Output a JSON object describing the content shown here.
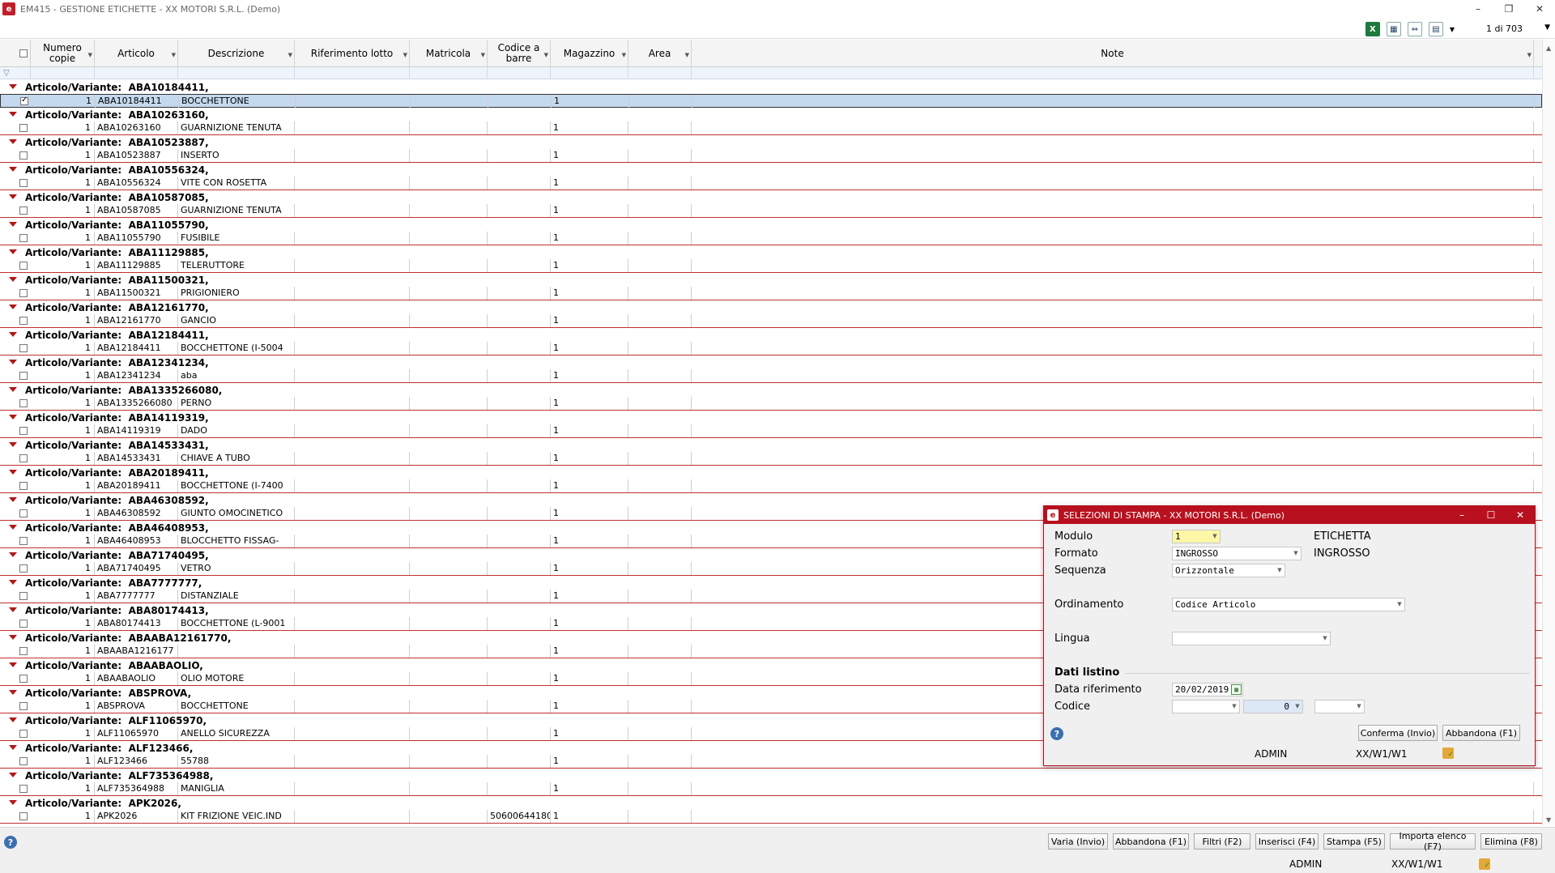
{
  "window": {
    "title": "EM415 - GESTIONE ETICHETTE - XX  MOTORI S.R.L.  (Demo)",
    "icon": "app-logo-icon"
  },
  "toolbar": {
    "pagecount": "1 di 703"
  },
  "columns": [
    {
      "key": "copie",
      "label": "Numero\ncopie"
    },
    {
      "key": "articolo",
      "label": "Articolo"
    },
    {
      "key": "descrizione",
      "label": "Descrizione"
    },
    {
      "key": "lotto",
      "label": "Riferimento lotto"
    },
    {
      "key": "matricola",
      "label": "Matricola"
    },
    {
      "key": "barre",
      "label": "Codice a\nbarre"
    },
    {
      "key": "magazzino",
      "label": "Magazzino"
    },
    {
      "key": "area",
      "label": "Area"
    },
    {
      "key": "note",
      "label": "Note"
    }
  ],
  "group_prefix": "Articolo/Variante:",
  "rows": [
    {
      "group": "ABA10184411,",
      "copie": "1",
      "articolo": "ABA10184411",
      "descrizione": "BOCCHETTONE",
      "barre": "",
      "magazzino": "1",
      "selected": true
    },
    {
      "group": "ABA10263160,",
      "copie": "1",
      "articolo": "ABA10263160",
      "descrizione": "GUARNIZIONE TENUTA",
      "barre": "",
      "magazzino": "1"
    },
    {
      "group": "ABA10523887,",
      "copie": "1",
      "articolo": "ABA10523887",
      "descrizione": "INSERTO",
      "barre": "",
      "magazzino": "1"
    },
    {
      "group": "ABA10556324,",
      "copie": "1",
      "articolo": "ABA10556324",
      "descrizione": "VITE CON ROSETTA",
      "barre": "",
      "magazzino": "1"
    },
    {
      "group": "ABA10587085,",
      "copie": "1",
      "articolo": "ABA10587085",
      "descrizione": "GUARNIZIONE TENUTA",
      "barre": "",
      "magazzino": "1"
    },
    {
      "group": "ABA11055790,",
      "copie": "1",
      "articolo": "ABA11055790",
      "descrizione": "FUSIBILE",
      "barre": "",
      "magazzino": "1"
    },
    {
      "group": "ABA11129885,",
      "copie": "1",
      "articolo": "ABA11129885",
      "descrizione": "TELERUTTORE",
      "barre": "",
      "magazzino": "1"
    },
    {
      "group": "ABA11500321,",
      "copie": "1",
      "articolo": "ABA11500321",
      "descrizione": "PRIGIONIERO",
      "barre": "",
      "magazzino": "1"
    },
    {
      "group": "ABA12161770,",
      "copie": "1",
      "articolo": "ABA12161770",
      "descrizione": "GANCIO",
      "barre": "",
      "magazzino": "1"
    },
    {
      "group": "ABA12184411,",
      "copie": "1",
      "articolo": "ABA12184411",
      "descrizione": "BOCCHETTONE (I-5004",
      "barre": "",
      "magazzino": "1"
    },
    {
      "group": "ABA12341234,",
      "copie": "1",
      "articolo": "ABA12341234",
      "descrizione": "aba",
      "barre": "",
      "magazzino": "1"
    },
    {
      "group": "ABA1335266080,",
      "copie": "1",
      "articolo": "ABA1335266080",
      "descrizione": "PERNO",
      "barre": "",
      "magazzino": "1"
    },
    {
      "group": "ABA14119319,",
      "copie": "1",
      "articolo": "ABA14119319",
      "descrizione": "DADO",
      "barre": "",
      "magazzino": "1"
    },
    {
      "group": "ABA14533431,",
      "copie": "1",
      "articolo": "ABA14533431",
      "descrizione": "CHIAVE A TUBO",
      "barre": "",
      "magazzino": "1"
    },
    {
      "group": "ABA20189411,",
      "copie": "1",
      "articolo": "ABA20189411",
      "descrizione": "BOCCHETTONE (I-7400",
      "barre": "",
      "magazzino": "1"
    },
    {
      "group": "ABA46308592,",
      "copie": "1",
      "articolo": "ABA46308592",
      "descrizione": "GIUNTO OMOCINETICO",
      "barre": "",
      "magazzino": "1"
    },
    {
      "group": "ABA46408953,",
      "copie": "1",
      "articolo": "ABA46408953",
      "descrizione": "BLOCCHETTO FISSAG-",
      "barre": "",
      "magazzino": "1"
    },
    {
      "group": "ABA71740495,",
      "copie": "1",
      "articolo": "ABA71740495",
      "descrizione": "VETRO",
      "barre": "",
      "magazzino": "1"
    },
    {
      "group": "ABA7777777,",
      "copie": "1",
      "articolo": "ABA7777777",
      "descrizione": "DISTANZIALE",
      "barre": "",
      "magazzino": "1"
    },
    {
      "group": "ABA80174413,",
      "copie": "1",
      "articolo": "ABA80174413",
      "descrizione": "BOCCHETTONE (L-9001",
      "barre": "",
      "magazzino": "1"
    },
    {
      "group": "ABAABA12161770,",
      "copie": "1",
      "articolo": "ABAABA1216177",
      "descrizione": "",
      "barre": "",
      "magazzino": "1"
    },
    {
      "group": "ABAABAOLIO,",
      "copie": "1",
      "articolo": "ABAABAOLIO",
      "descrizione": "OLIO MOTORE",
      "barre": "",
      "magazzino": "1"
    },
    {
      "group": "ABSPROVA,",
      "copie": "1",
      "articolo": "ABSPROVA",
      "descrizione": "BOCCHETTONE",
      "barre": "",
      "magazzino": "1"
    },
    {
      "group": "ALF11065970,",
      "copie": "1",
      "articolo": "ALF11065970",
      "descrizione": "ANELLO SICUREZZA",
      "barre": "",
      "magazzino": "1"
    },
    {
      "group": "ALF123466,",
      "copie": "1",
      "articolo": "ALF123466",
      "descrizione": "55788",
      "barre": "",
      "magazzino": "1"
    },
    {
      "group": "ALF735364988,",
      "copie": "1",
      "articolo": "ALF735364988",
      "descrizione": "MANIGLIA",
      "barre": "",
      "magazzino": "1"
    },
    {
      "group": "APK2026,",
      "copie": "1",
      "articolo": "APK2026",
      "descrizione": "KIT FRIZIONE VEIC.IND",
      "barre": "50600644180",
      "magazzino": "1"
    }
  ],
  "bottom_buttons": [
    "Varia (Invio)",
    "Abbandona (F1)",
    "Filtri (F2)",
    "Inserisci (F4)",
    "Stampa (F5)",
    "Importa elenco (F7)",
    "Elimina (F8)"
  ],
  "status": {
    "user": "ADMIN",
    "path": "XX/W1/W1"
  },
  "dialog": {
    "title": "SELEZIONI DI STAMPA - XX  MOTORI S.R.L.  (Demo)",
    "modulo_label": "Modulo",
    "modulo_value": "1",
    "modulo_desc": "ETICHETTA",
    "formato_label": "Formato",
    "formato_value": "INGROSSO",
    "formato_desc": "INGROSSO",
    "sequenza_label": "Sequenza",
    "sequenza_value": "Orizzontale",
    "ordinamento_label": "Ordinamento",
    "ordinamento_value": "Codice Articolo",
    "lingua_label": "Lingua",
    "lingua_value": "",
    "section": "Dati listino",
    "data_label": "Data riferimento",
    "data_value": "20/02/2019",
    "codice_label": "Codice",
    "codice_num": "0",
    "confirm": "Conferma (Invio)",
    "cancel": "Abbandona (F1)",
    "user": "ADMIN",
    "path": "XX/W1/W1"
  }
}
